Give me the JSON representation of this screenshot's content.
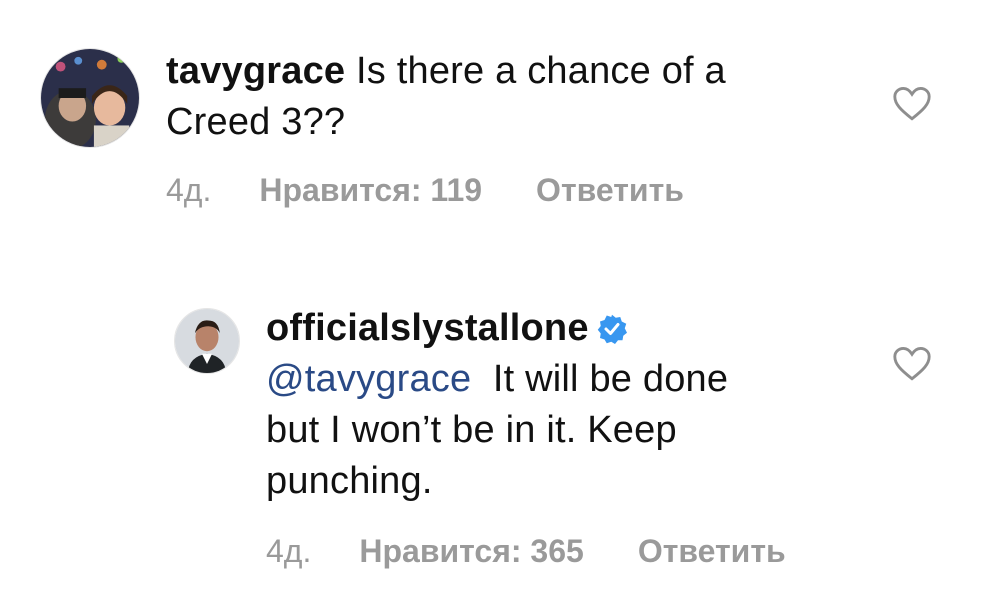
{
  "comments": [
    {
      "username": "tavygrace",
      "text": "Is there a chance of a",
      "text_line2": "Creed 3??",
      "time": "4д.",
      "likes": "Нравится: 119",
      "reply": "Ответить",
      "avatar_icon": "user-avatar-photo",
      "like_icon": "heart-outline-icon"
    },
    {
      "username": "officialslystallone",
      "verified_icon": "verified-badge-icon",
      "mention": "@tavygrace",
      "text": "It will be done",
      "text_line2": "but I won’t be in it. Keep",
      "text_line3": "punching.",
      "time": "4д.",
      "likes": "Нравится: 365",
      "reply": "Ответить",
      "avatar_icon": "user-avatar-photo",
      "like_icon": "heart-outline-icon"
    }
  ],
  "colors": {
    "verified": "#3897f0",
    "mention": "#2a4a86",
    "meta": "#9a9a9a"
  }
}
